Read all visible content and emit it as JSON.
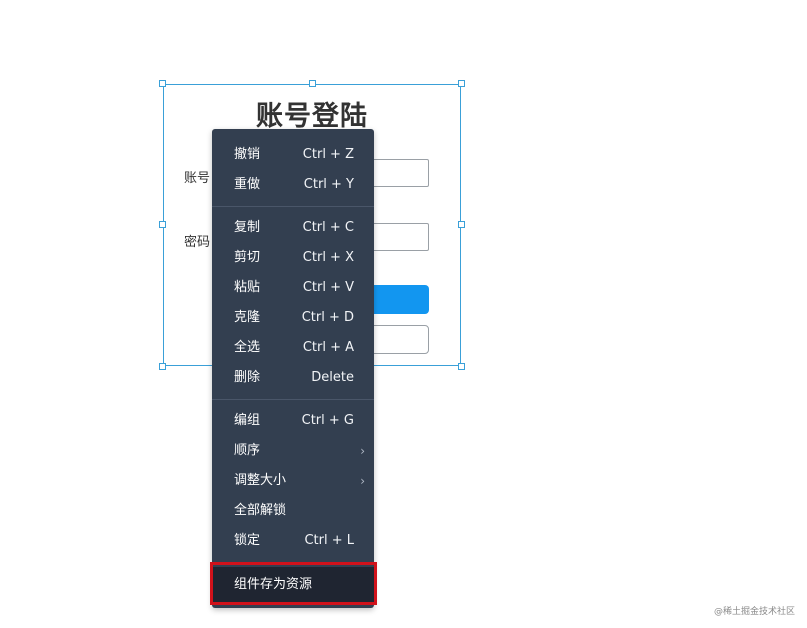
{
  "form": {
    "title": "账号登陆",
    "account_label": "账号",
    "password_label": "密码"
  },
  "context_menu": {
    "items": [
      {
        "label": "撤销",
        "shortcut": "Ctrl + Z"
      },
      {
        "label": "重做",
        "shortcut": "Ctrl + Y"
      },
      {
        "label": "复制",
        "shortcut": "Ctrl + C"
      },
      {
        "label": "剪切",
        "shortcut": "Ctrl + X"
      },
      {
        "label": "粘贴",
        "shortcut": "Ctrl + V"
      },
      {
        "label": "克隆",
        "shortcut": "Ctrl + D"
      },
      {
        "label": "全选",
        "shortcut": "Ctrl + A"
      },
      {
        "label": "删除",
        "shortcut": "Delete"
      },
      {
        "label": "编组",
        "shortcut": "Ctrl + G"
      },
      {
        "label": "顺序",
        "shortcut": "›"
      },
      {
        "label": "调整大小",
        "shortcut": "›"
      },
      {
        "label": "全部解锁",
        "shortcut": ""
      },
      {
        "label": "锁定",
        "shortcut": "Ctrl + L"
      },
      {
        "label": "组件存为资源",
        "shortcut": ""
      }
    ]
  },
  "watermark": "@稀土掘金技术社区",
  "colors": {
    "menu_bg": "#333f50",
    "menu_highlight_bg": "#1f2531",
    "highlight_outline": "#d0121b",
    "selection": "#3aa0d8",
    "primary_button": "#1296f0"
  }
}
